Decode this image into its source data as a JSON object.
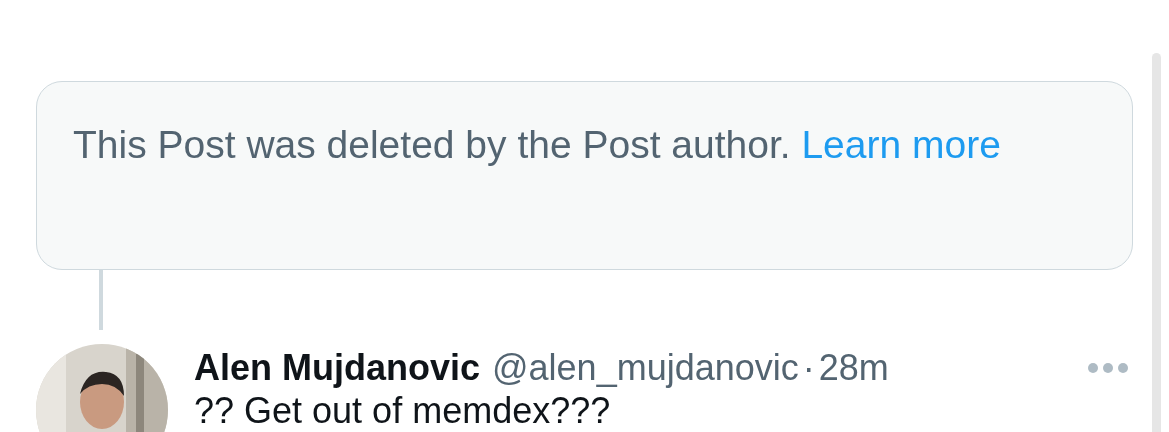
{
  "notice": {
    "text": "This Post was deleted by the Post author.",
    "link": "Learn more"
  },
  "reply": {
    "author": {
      "name": "Alen Mujdanovic",
      "handle": "@alen_mujdanovic",
      "separator": "·",
      "time": "28m"
    },
    "text": "?? Get out of memdex???"
  }
}
